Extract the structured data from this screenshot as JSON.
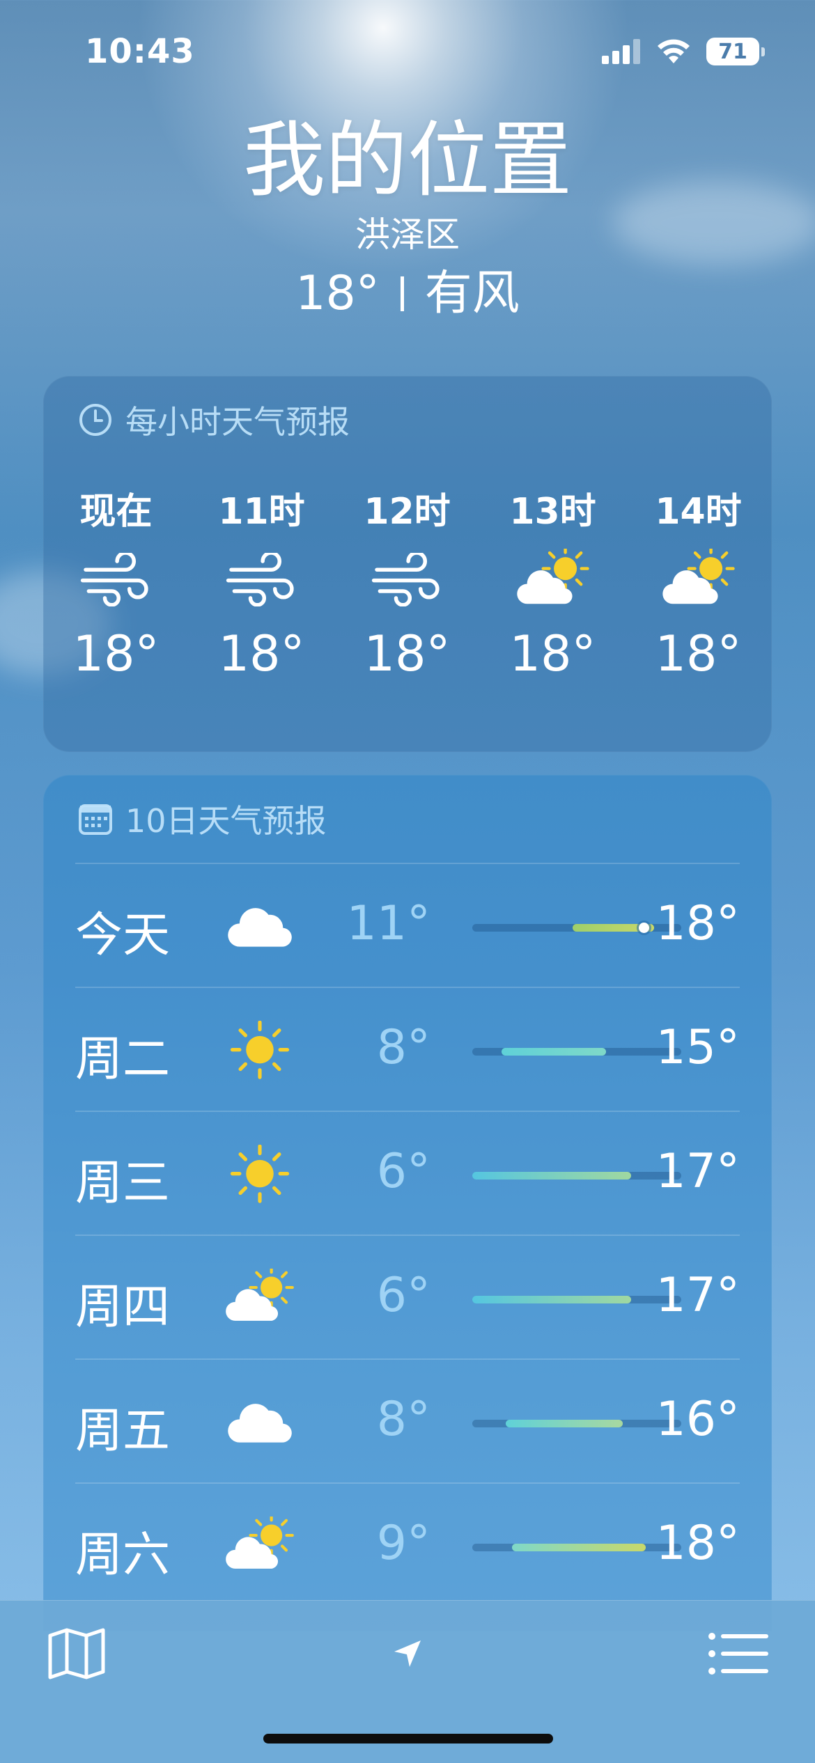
{
  "status_bar": {
    "time": "10:43",
    "battery": "71"
  },
  "header": {
    "location": "我的位置",
    "district": "洪泽区",
    "temperature": "18°",
    "condition": "有风"
  },
  "hourly": {
    "title": "每小时天气预报",
    "icon": "clock-icon",
    "items": [
      {
        "label": "现在",
        "icon": "wind-icon",
        "temp": "18°"
      },
      {
        "label": "11时",
        "icon": "wind-icon",
        "temp": "18°"
      },
      {
        "label": "12时",
        "icon": "wind-icon",
        "temp": "18°"
      },
      {
        "label": "13时",
        "icon": "partly-cloudy-icon",
        "temp": "18°"
      },
      {
        "label": "14时",
        "icon": "partly-cloudy-icon",
        "temp": "18°"
      }
    ]
  },
  "daily": {
    "title": "10日天气预报",
    "icon": "calendar-icon",
    "days": [
      {
        "name": "今天",
        "icon": "cloud-icon",
        "low": "11°",
        "high": "18°",
        "range_start": 0.48,
        "range_end": 0.87,
        "current": 0.82,
        "gradient": "#9fcf6a,#c9d86a"
      },
      {
        "name": "周二",
        "icon": "sun-icon",
        "low": "8°",
        "high": "15°",
        "range_start": 0.14,
        "range_end": 0.64,
        "gradient": "#5fd1d8,#7fd8c8"
      },
      {
        "name": "周三",
        "icon": "sun-icon",
        "low": "6°",
        "high": "17°",
        "range_start": 0.0,
        "range_end": 0.76,
        "gradient": "#55c6e0,#a0d8a0"
      },
      {
        "name": "周四",
        "icon": "partly-cloudy-icon",
        "low": "6°",
        "high": "17°",
        "range_start": 0.0,
        "range_end": 0.76,
        "gradient": "#55c6e0,#a0d8a0"
      },
      {
        "name": "周五",
        "icon": "cloud-icon",
        "low": "8°",
        "high": "16°",
        "range_start": 0.16,
        "range_end": 0.72,
        "gradient": "#5fd1d8,#a8d8a0"
      },
      {
        "name": "周六",
        "icon": "partly-cloudy-icon",
        "low": "9°",
        "high": "18°",
        "range_start": 0.19,
        "range_end": 0.83,
        "gradient": "#7fd8c8,#c9d86a"
      }
    ]
  },
  "bottom_bar": {
    "map": "map-icon",
    "location": "location-arrow-icon",
    "list": "list-icon"
  }
}
